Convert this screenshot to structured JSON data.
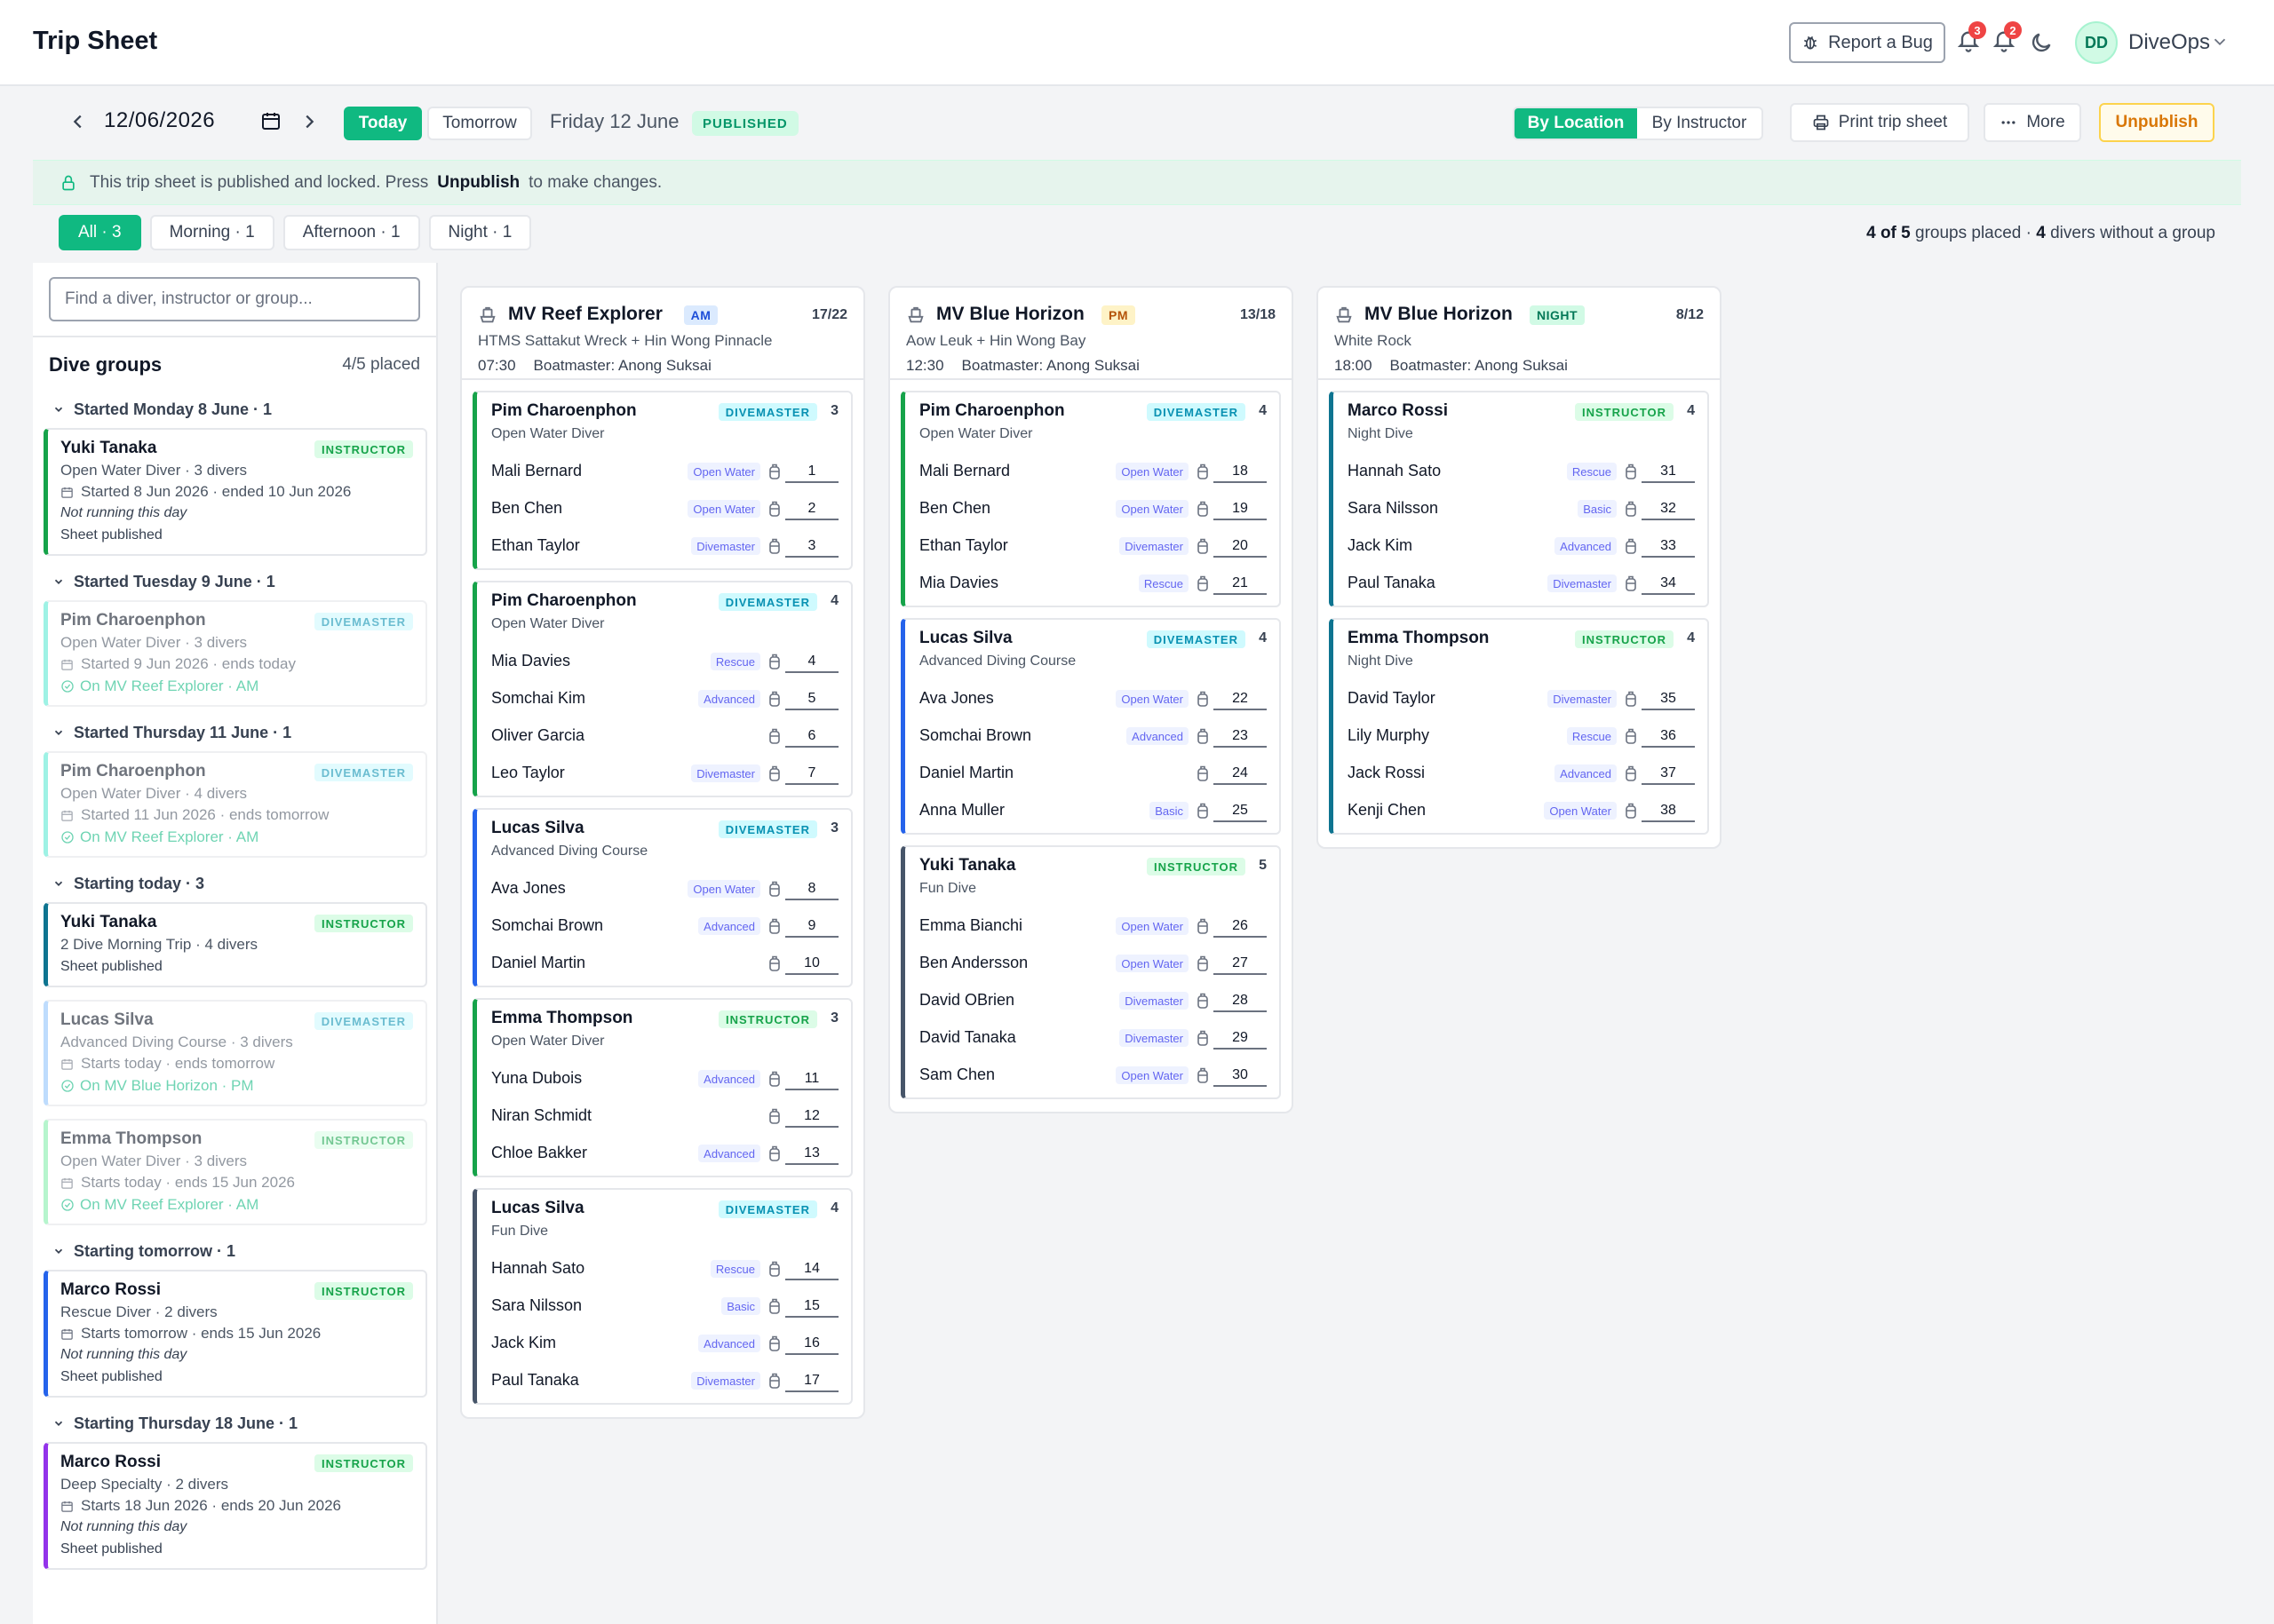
{
  "app": {
    "title": "Trip Sheet",
    "report_bug": "Report a Bug",
    "notif_count_1": "3",
    "notif_count_2": "2",
    "avatar_initials": "DD",
    "org_name": "DiveOps"
  },
  "toolbar": {
    "date": "12/06/2026",
    "today": "Today",
    "tomorrow": "Tomorrow",
    "day_label": "Friday 12 June",
    "status": "PUBLISHED",
    "view_by_location": "By Location",
    "view_by_instructor": "By Instructor",
    "print": "Print trip sheet",
    "more": "More",
    "unpublish": "Unpublish"
  },
  "banner": {
    "text_before": "This trip sheet is published and locked. Press",
    "action": "Unpublish",
    "text_after": "to make changes."
  },
  "filters": {
    "chips": [
      "All · 3",
      "Morning · 1",
      "Afternoon · 1",
      "Night · 1"
    ],
    "summary_placed": "4 of 5",
    "summary_mid": "groups placed ·",
    "summary_without": "4",
    "summary_end": "divers without a group"
  },
  "left": {
    "search_placeholder": "Find a diver, instructor or group...",
    "title": "Dive groups",
    "count": "4/5 placed",
    "sections": [
      {
        "heading": "Started Monday 8 June · 1",
        "cards": [
          {
            "name": "Yuki Tanaka",
            "role": "INSTRUCTOR",
            "course": "Open Water Diver · 3 divers",
            "dates": "Started 8 Jun 2026 · ended 10 Jun 2026",
            "note": "Not running this day",
            "status": "Sheet published"
          }
        ]
      },
      {
        "heading": "Started Tuesday 9 June · 1",
        "cards": [
          {
            "name": "Pim Charoenphon",
            "role": "DIVEMASTER",
            "course": "Open Water Diver · 3 divers",
            "dates": "Started 9 Jun 2026 · ends today",
            "on": "On MV Reef Explorer · AM"
          }
        ]
      },
      {
        "heading": "Started Thursday 11 June · 1",
        "cards": [
          {
            "name": "Pim Charoenphon",
            "role": "DIVEMASTER",
            "course": "Open Water Diver · 4 divers",
            "dates": "Started 11 Jun 2026 · ends tomorrow",
            "on": "On MV Reef Explorer · AM"
          }
        ]
      },
      {
        "heading": "Starting today · 3",
        "cards": [
          {
            "name": "Yuki Tanaka",
            "role": "INSTRUCTOR",
            "course": "2 Dive Morning Trip · 4 divers",
            "status": "Sheet published"
          },
          {
            "name": "Lucas Silva",
            "role": "DIVEMASTER",
            "course": "Advanced Diving Course · 3 divers",
            "dates": "Starts today · ends tomorrow",
            "on": "On MV Blue Horizon · PM"
          },
          {
            "name": "Emma Thompson",
            "role": "INSTRUCTOR",
            "course": "Open Water Diver · 3 divers",
            "dates": "Starts today · ends 15 Jun 2026",
            "on": "On MV Reef Explorer · AM"
          }
        ]
      },
      {
        "heading": "Starting tomorrow · 1",
        "cards": [
          {
            "name": "Marco Rossi",
            "role": "INSTRUCTOR",
            "course": "Rescue Diver · 2 divers",
            "dates": "Starts tomorrow · ends 15 Jun 2026",
            "note": "Not running this day",
            "status": "Sheet published"
          }
        ]
      },
      {
        "heading": "Starting Thursday 18 June · 1",
        "cards": [
          {
            "name": "Marco Rossi",
            "role": "INSTRUCTOR",
            "course": "Deep Specialty · 2 divers",
            "dates": "Starts 18 Jun 2026 · ends 20 Jun 2026",
            "note": "Not running this day",
            "status": "Sheet published"
          }
        ]
      }
    ]
  },
  "boats": [
    {
      "name": "MV Reef Explorer",
      "slot": "AM",
      "capacity": "17/22",
      "site": "HTMS Sattakut Wreck + Hin Wong Pinnacle",
      "time": "07:30",
      "boatmaster": "Boatmaster: Anong Suksai",
      "groups": [
        {
          "leader": "Pim Charoenphon",
          "role": "DIVEMASTER",
          "count": "3",
          "course": "Open Water Diver",
          "divers": [
            {
              "name": "Mali Bernard",
              "cert": "Open Water",
              "num": "1"
            },
            {
              "name": "Ben Chen",
              "cert": "Open Water",
              "num": "2"
            },
            {
              "name": "Ethan Taylor",
              "cert": "Divemaster",
              "num": "3"
            }
          ]
        },
        {
          "leader": "Pim Charoenphon",
          "role": "DIVEMASTER",
          "count": "4",
          "course": "Open Water Diver",
          "divers": [
            {
              "name": "Mia Davies",
              "cert": "Rescue",
              "num": "4"
            },
            {
              "name": "Somchai Kim",
              "cert": "Advanced",
              "num": "5"
            },
            {
              "name": "Oliver Garcia",
              "cert": "",
              "num": "6"
            },
            {
              "name": "Leo Taylor",
              "cert": "Divemaster",
              "num": "7"
            }
          ]
        },
        {
          "leader": "Lucas Silva",
          "role": "DIVEMASTER",
          "count": "3",
          "course": "Advanced Diving Course",
          "divers": [
            {
              "name": "Ava Jones",
              "cert": "Open Water",
              "num": "8"
            },
            {
              "name": "Somchai Brown",
              "cert": "Advanced",
              "num": "9"
            },
            {
              "name": "Daniel Martin",
              "cert": "",
              "num": "10"
            }
          ]
        },
        {
          "leader": "Emma Thompson",
          "role": "INSTRUCTOR",
          "count": "3",
          "course": "Open Water Diver",
          "divers": [
            {
              "name": "Yuna Dubois",
              "cert": "Advanced",
              "num": "11"
            },
            {
              "name": "Niran Schmidt",
              "cert": "",
              "num": "12"
            },
            {
              "name": "Chloe Bakker",
              "cert": "Advanced",
              "num": "13"
            }
          ]
        },
        {
          "leader": "Lucas Silva",
          "role": "DIVEMASTER",
          "count": "4",
          "course": "Fun Dive",
          "divers": [
            {
              "name": "Hannah Sato",
              "cert": "Rescue",
              "num": "14"
            },
            {
              "name": "Sara Nilsson",
              "cert": "Basic",
              "num": "15"
            },
            {
              "name": "Jack Kim",
              "cert": "Advanced",
              "num": "16"
            },
            {
              "name": "Paul Tanaka",
              "cert": "Divemaster",
              "num": "17"
            }
          ]
        }
      ]
    },
    {
      "name": "MV Blue Horizon",
      "slot": "PM",
      "capacity": "13/18",
      "site": "Aow Leuk + Hin Wong Bay",
      "time": "12:30",
      "boatmaster": "Boatmaster: Anong Suksai",
      "groups": [
        {
          "leader": "Pim Charoenphon",
          "role": "DIVEMASTER",
          "count": "4",
          "course": "Open Water Diver",
          "divers": [
            {
              "name": "Mali Bernard",
              "cert": "Open Water",
              "num": "18"
            },
            {
              "name": "Ben Chen",
              "cert": "Open Water",
              "num": "19"
            },
            {
              "name": "Ethan Taylor",
              "cert": "Divemaster",
              "num": "20"
            },
            {
              "name": "Mia Davies",
              "cert": "Rescue",
              "num": "21"
            }
          ]
        },
        {
          "leader": "Lucas Silva",
          "role": "DIVEMASTER",
          "count": "4",
          "course": "Advanced Diving Course",
          "divers": [
            {
              "name": "Ava Jones",
              "cert": "Open Water",
              "num": "22"
            },
            {
              "name": "Somchai Brown",
              "cert": "Advanced",
              "num": "23"
            },
            {
              "name": "Daniel Martin",
              "cert": "",
              "num": "24"
            },
            {
              "name": "Anna Muller",
              "cert": "Basic",
              "num": "25"
            }
          ]
        },
        {
          "leader": "Yuki Tanaka",
          "role": "INSTRUCTOR",
          "count": "5",
          "course": "Fun Dive",
          "divers": [
            {
              "name": "Emma Bianchi",
              "cert": "Open Water",
              "num": "26"
            },
            {
              "name": "Ben Andersson",
              "cert": "Open Water",
              "num": "27"
            },
            {
              "name": "David OBrien",
              "cert": "Divemaster",
              "num": "28"
            },
            {
              "name": "David Tanaka",
              "cert": "Divemaster",
              "num": "29"
            },
            {
              "name": "Sam Chen",
              "cert": "Open Water",
              "num": "30"
            }
          ]
        }
      ]
    },
    {
      "name": "MV Blue Horizon",
      "slot": "NIGHT",
      "capacity": "8/12",
      "site": "White Rock",
      "time": "18:00",
      "boatmaster": "Boatmaster: Anong Suksai",
      "groups": [
        {
          "leader": "Marco Rossi",
          "role": "INSTRUCTOR",
          "count": "4",
          "course": "Night Dive",
          "divers": [
            {
              "name": "Hannah Sato",
              "cert": "Rescue",
              "num": "31"
            },
            {
              "name": "Sara Nilsson",
              "cert": "Basic",
              "num": "32"
            },
            {
              "name": "Jack Kim",
              "cert": "Advanced",
              "num": "33"
            },
            {
              "name": "Paul Tanaka",
              "cert": "Divemaster",
              "num": "34"
            }
          ]
        },
        {
          "leader": "Emma Thompson",
          "role": "INSTRUCTOR",
          "count": "4",
          "course": "Night Dive",
          "divers": [
            {
              "name": "David Taylor",
              "cert": "Divemaster",
              "num": "35"
            },
            {
              "name": "Lily Murphy",
              "cert": "Rescue",
              "num": "36"
            },
            {
              "name": "Jack Rossi",
              "cert": "Advanced",
              "num": "37"
            },
            {
              "name": "Kenji Chen",
              "cert": "Open Water",
              "num": "38"
            }
          ]
        }
      ]
    }
  ],
  "colors": {
    "accent": "#10b981",
    "instructor": "#16a34a",
    "divemaster": "#0891b2",
    "unpublish": "#d97706"
  },
  "icons": [
    "bug-icon",
    "bell-icon",
    "moon-icon",
    "chevron-down-icon",
    "chevron-left-icon",
    "chevron-right-icon",
    "calendar-icon",
    "printer-icon",
    "more-icon",
    "lock-icon",
    "search-icon",
    "boat-icon",
    "tank-icon",
    "check-circle-icon"
  ]
}
